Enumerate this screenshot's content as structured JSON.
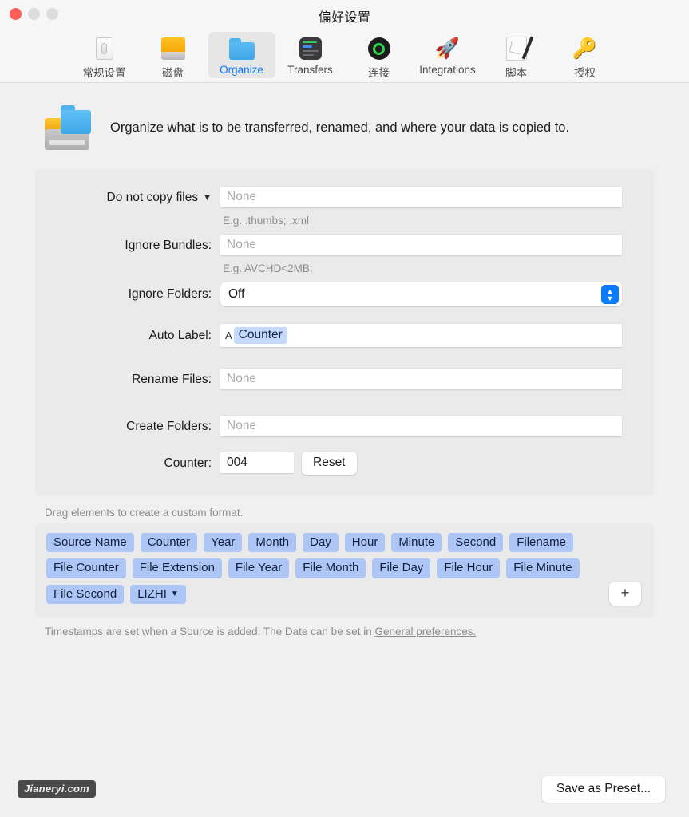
{
  "window": {
    "title": "偏好设置",
    "traffic_lights": [
      "close",
      "minimize",
      "maximize"
    ]
  },
  "toolbar": {
    "items": [
      {
        "label": "常规设置",
        "icon": "switch-icon",
        "selected": false
      },
      {
        "label": "磁盘",
        "icon": "disk-icon",
        "selected": false
      },
      {
        "label": "Organize",
        "icon": "folder-icon",
        "selected": true
      },
      {
        "label": "Transfers",
        "icon": "transfers-icon",
        "selected": false
      },
      {
        "label": "连接",
        "icon": "connect-icon",
        "selected": false
      },
      {
        "label": "Integrations",
        "icon": "rocket-icon",
        "selected": false
      },
      {
        "label": "脚本",
        "icon": "script-icon",
        "selected": false
      },
      {
        "label": "授权",
        "icon": "key-icon",
        "selected": false
      }
    ]
  },
  "pane": {
    "description": "Organize what is to be transferred, renamed, and where your data is copied to."
  },
  "form": {
    "do_not_copy": {
      "label": "Do not copy files",
      "placeholder": "None",
      "value": "",
      "hint": "E.g. .thumbs; .xml"
    },
    "ignore_bundles": {
      "label": "Ignore Bundles:",
      "placeholder": "None",
      "value": "",
      "hint": "E.g. AVCHD<2MB;"
    },
    "ignore_folders": {
      "label": "Ignore Folders:",
      "value": "Off"
    },
    "auto_label": {
      "label": "Auto Label:",
      "literal": "A",
      "token": "Counter"
    },
    "rename_files": {
      "label": "Rename Files:",
      "placeholder": "None",
      "value": ""
    },
    "create_folders": {
      "label": "Create Folders:",
      "placeholder": "None",
      "value": ""
    },
    "counter": {
      "label": "Counter:",
      "value": "004",
      "reset_label": "Reset"
    }
  },
  "drag": {
    "hint": "Drag elements to create a custom format.",
    "rows": [
      [
        "Source Name",
        "Counter",
        "Year",
        "Month",
        "Day",
        "Hour",
        "Minute",
        "Second",
        "Filename"
      ],
      [
        "File Counter",
        "File Extension",
        "File Year",
        "File Month",
        "File Day",
        "File Hour",
        "File Minute"
      ],
      [
        "File Second"
      ]
    ],
    "menu_token": "LIZHI",
    "add_label": "+",
    "footnote_prefix": "Timestamps are set when a Source is added. The Date can be set in ",
    "footnote_link": "General preferences."
  },
  "footer": {
    "watermark": "Jianeryi.com",
    "save_preset": "Save as Preset..."
  },
  "colors": {
    "accent": "#0a7bff",
    "token_bg": "#aec6f5",
    "panel_bg": "#eaeaea",
    "window_bg": "#f0f0f0"
  }
}
